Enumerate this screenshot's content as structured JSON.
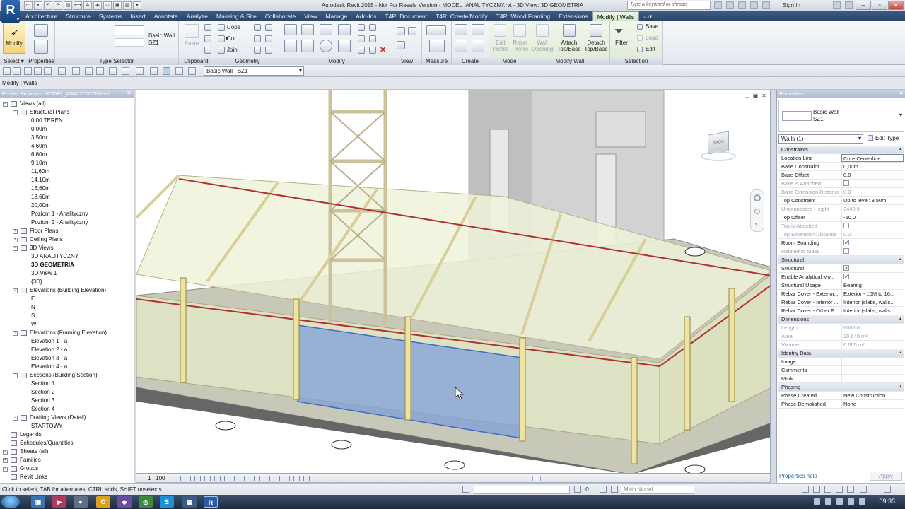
{
  "window": {
    "title": "Autodesk Revit 2015 - Not For Resale Version -    MODEL_ANALITYCZNY.rvt - 3D View: 3D GEOMETRIA",
    "search_placeholder": "Type a keyword or phrase",
    "sign_in": "Sign In"
  },
  "tabs": [
    "Architecture",
    "Structure",
    "Systems",
    "Insert",
    "Annotate",
    "Analyze",
    "Massing & Site",
    "Collaborate",
    "View",
    "Manage",
    "Add-Ins",
    "T4R: Document",
    "T4R: Create/Modify",
    "T4R: Wood Framing",
    "Extensions",
    "Modify | Walls"
  ],
  "ribbon": {
    "modify_label": "Modify",
    "type_name": "Basic Wall",
    "type_sub": "SZ1",
    "paste_label": "Paste",
    "clipboard": {
      "cope": "Cope",
      "cut": "Cut",
      "join": "Join"
    },
    "attach_label": "Attach\nTop/Base",
    "detach_label": "Detach\nTop/Base",
    "edit_profile": "Edit\nProfile",
    "reset_profile": "Reset\nProfile",
    "wall_opening": "Wall\nOpening",
    "filter_label": "Filter",
    "save_label": "Save",
    "load_label": "Load",
    "edit_label": "Edit",
    "panels": {
      "select": "Select",
      "properties": "Properties",
      "type_selector": "Type Selector",
      "clipboard": "Clipboard",
      "geometry": "Geometry",
      "modify": "Modify",
      "view": "View",
      "measure": "Measure",
      "create": "Create",
      "mode": "Mode",
      "modify_wall": "Modify Wall",
      "selection": "Selection"
    }
  },
  "options_bar": {
    "type_dropdown": "Basic Wall : SZ1"
  },
  "context_label": "Modify | Walls",
  "browser": {
    "header": "Project Browser - MODEL_ANALITYCZNY.rvt",
    "items": [
      {
        "label": "Views (all)",
        "depth": 0,
        "exp": "-"
      },
      {
        "label": "Structural Plans",
        "depth": 1,
        "exp": "-"
      },
      {
        "label": "0,00 TEREN",
        "depth": 2
      },
      {
        "label": "0,00m",
        "depth": 2
      },
      {
        "label": "3,50m",
        "depth": 2
      },
      {
        "label": "4,60m",
        "depth": 2
      },
      {
        "label": "6,60m",
        "depth": 2
      },
      {
        "label": "9,10m",
        "depth": 2
      },
      {
        "label": "11,60m",
        "depth": 2
      },
      {
        "label": "14,10m",
        "depth": 2
      },
      {
        "label": "16,60m",
        "depth": 2
      },
      {
        "label": "18,60m",
        "depth": 2
      },
      {
        "label": "20,00m",
        "depth": 2
      },
      {
        "label": "Poziom 1 - Analityczny",
        "depth": 2
      },
      {
        "label": "Poziom 2 - Analityczny",
        "depth": 2
      },
      {
        "label": "Floor Plans",
        "depth": 1,
        "exp": "+"
      },
      {
        "label": "Ceiling Plans",
        "depth": 1,
        "exp": "+"
      },
      {
        "label": "3D Views",
        "depth": 1,
        "exp": "-"
      },
      {
        "label": "3D ANALITYCZNY",
        "depth": 2
      },
      {
        "label": "3D GEOMETRIA",
        "depth": 2,
        "bold": true
      },
      {
        "label": "3D View 1",
        "depth": 2
      },
      {
        "label": "{3D}",
        "depth": 2
      },
      {
        "label": "Elevations (Building Elevation)",
        "depth": 1,
        "exp": "-"
      },
      {
        "label": "E",
        "depth": 2
      },
      {
        "label": "N",
        "depth": 2
      },
      {
        "label": "S",
        "depth": 2
      },
      {
        "label": "W",
        "depth": 2
      },
      {
        "label": "Elevations (Framing Elevation)",
        "depth": 1,
        "exp": "-"
      },
      {
        "label": "Elevation 1 - a",
        "depth": 2
      },
      {
        "label": "Elevation 2 - a",
        "depth": 2
      },
      {
        "label": "Elevation 3 - a",
        "depth": 2
      },
      {
        "label": "Elevation 4 - a",
        "depth": 2
      },
      {
        "label": "Sections (Building Section)",
        "depth": 1,
        "exp": "-"
      },
      {
        "label": "Section 1",
        "depth": 2
      },
      {
        "label": "Section 2",
        "depth": 2
      },
      {
        "label": "Section 3",
        "depth": 2
      },
      {
        "label": "Section 4",
        "depth": 2
      },
      {
        "label": "Drafting Views (Detail)",
        "depth": 1,
        "exp": "-"
      },
      {
        "label": "STARTOWY",
        "depth": 2
      },
      {
        "label": "Legends",
        "depth": 0,
        "exp": ""
      },
      {
        "label": "Schedules/Quantities",
        "depth": 0,
        "exp": ""
      },
      {
        "label": "Sheets (all)",
        "depth": 0,
        "exp": "+"
      },
      {
        "label": "Families",
        "depth": 0,
        "exp": "+"
      },
      {
        "label": "Groups",
        "depth": 0,
        "exp": "+"
      },
      {
        "label": "Revit Links",
        "depth": 0,
        "exp": ""
      }
    ]
  },
  "view_control": {
    "scale": "1 : 100"
  },
  "properties": {
    "header": "Properties",
    "type_name": "Basic Wall",
    "type_sub": "SZ1",
    "filter": "Walls (1)",
    "edit_type": "Edit Type",
    "rows": [
      {
        "group": "Constraints"
      },
      {
        "name": "Location Line",
        "value": "Core Centerline",
        "editing": true
      },
      {
        "name": "Base Constraint",
        "value": "0,00m"
      },
      {
        "name": "Base Offset",
        "value": "0.0"
      },
      {
        "name": "Base is Attached",
        "check": false,
        "dis": true
      },
      {
        "name": "Base Extension Distance",
        "value": "0.0",
        "dis": true
      },
      {
        "name": "Top Constraint",
        "value": "Up to level: 3,50m"
      },
      {
        "name": "Unconnected Height",
        "value": "3440.0",
        "dis": true
      },
      {
        "name": "Top Offset",
        "value": "-60.0"
      },
      {
        "name": "Top is Attached",
        "check": false,
        "dis": true
      },
      {
        "name": "Top Extension Distance",
        "value": "0.0",
        "dis": true
      },
      {
        "name": "Room Bounding",
        "check": true
      },
      {
        "name": "Related to Mass",
        "check": false,
        "dis": true
      },
      {
        "group": "Structural"
      },
      {
        "name": "Structural",
        "check": true
      },
      {
        "name": "Enable Analytical Mo...",
        "check": true
      },
      {
        "name": "Structural Usage",
        "value": "Bearing"
      },
      {
        "name": "Rebar Cover - Exterior...",
        "value": "Exterior - 10M to 16..."
      },
      {
        "name": "Rebar Cover - Interior ...",
        "value": "Interior (slabs, walls..."
      },
      {
        "name": "Rebar Cover - Other F...",
        "value": "Interior (slabs, walls..."
      },
      {
        "group": "Dimensions"
      },
      {
        "name": "Length",
        "value": "6000.0",
        "dis": true
      },
      {
        "name": "Area",
        "value": "20.640 m²",
        "dis": true
      },
      {
        "name": "Volume",
        "value": "6.605 m³",
        "dis": true
      },
      {
        "group": "Identity Data"
      },
      {
        "name": "Image",
        "value": ""
      },
      {
        "name": "Comments",
        "value": ""
      },
      {
        "name": "Mark",
        "value": ""
      },
      {
        "group": "Phasing"
      },
      {
        "name": "Phase Created",
        "value": "New Construction"
      },
      {
        "name": "Phase Demolished",
        "value": "None"
      }
    ],
    "help": "Properties help",
    "apply": "Apply"
  },
  "status": {
    "text": "Click to select, TAB for alternates, CTRL adds, SHIFT unselects.",
    "zero": ":0",
    "model": "Main Model"
  },
  "viewcube": {
    "face": "BACK"
  },
  "taskbar": {
    "clock": "09:35"
  }
}
